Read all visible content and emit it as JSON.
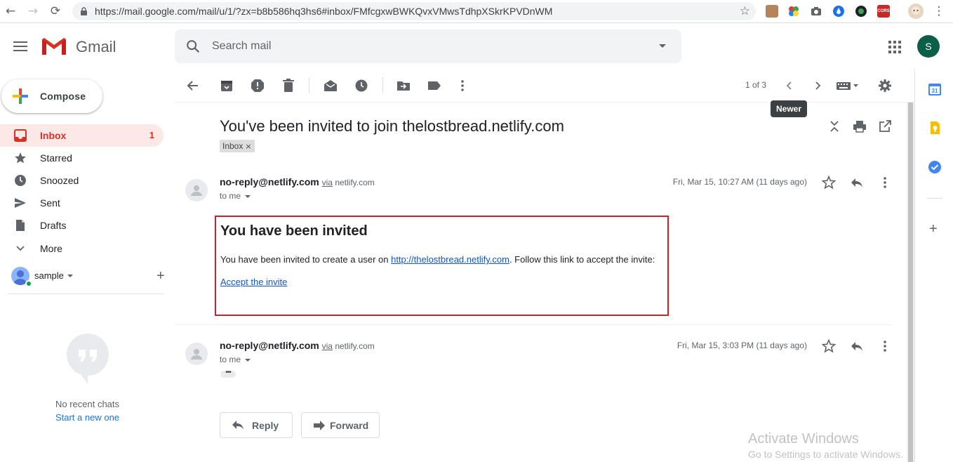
{
  "browser": {
    "url": "https://mail.google.com/mail/u/1/?zx=b8b586hq3hs6#inbox/FMfcgxwBWKQvxVMwsTdhpXSkrKPVDnWM",
    "back_icon": "←",
    "forward_icon": "→",
    "reload_icon": "⟳",
    "star_icon": "☆",
    "menu_icon": "⋮",
    "extension_cors_label": "CORS"
  },
  "header": {
    "app_name": "Gmail",
    "search_placeholder": "Search mail",
    "avatar_initial": "S"
  },
  "sidebar": {
    "compose_label": "Compose",
    "items": [
      {
        "label": "Inbox",
        "count": "1",
        "icon": "inbox-icon"
      },
      {
        "label": "Starred",
        "count": "",
        "icon": "star-icon"
      },
      {
        "label": "Snoozed",
        "count": "",
        "icon": "clock-icon"
      },
      {
        "label": "Sent",
        "count": "",
        "icon": "send-icon"
      },
      {
        "label": "Drafts",
        "count": "",
        "icon": "draft-icon"
      },
      {
        "label": "More",
        "count": "",
        "icon": "chevron-down-icon"
      }
    ],
    "hangouts_user": "sample",
    "no_chats": "No recent chats",
    "start_new": "Start a new one"
  },
  "toolbar": {
    "pager": "1 of 3",
    "tooltip": "Newer"
  },
  "thread": {
    "subject": "You've been invited to join thelostbread.netlify.com",
    "label": "Inbox",
    "label_remove": "×",
    "messages": [
      {
        "sender": "no-reply@netlify.com",
        "via": "via",
        "via_domain": "netlify.com",
        "to": "to me",
        "date": "Fri, Mar 15, 10:27 AM (11 days ago)"
      },
      {
        "sender": "no-reply@netlify.com",
        "via": "via",
        "via_domain": "netlify.com",
        "to": "to me",
        "date": "Fri, Mar 15, 3:03 PM (11 days ago)"
      }
    ],
    "body": {
      "title": "You have been invited",
      "text_before": "You have been invited to create a user on ",
      "link": "http://thelostbread.netlify.com",
      "text_after": ". Follow this link to accept the invite:",
      "accept_link": "Accept the invite"
    },
    "trimmed": "•••",
    "reply_label": "Reply",
    "forward_label": "Forward"
  },
  "watermark": {
    "line1": "Activate Windows",
    "line2": "Go to Settings to activate Windows."
  },
  "right_panel": {
    "calendar_day": "31"
  },
  "colors": {
    "accent_red": "#d93025",
    "link_blue": "#1155cc",
    "highlight_border": "#c8232c",
    "avatar_green": "#0b5e47"
  }
}
